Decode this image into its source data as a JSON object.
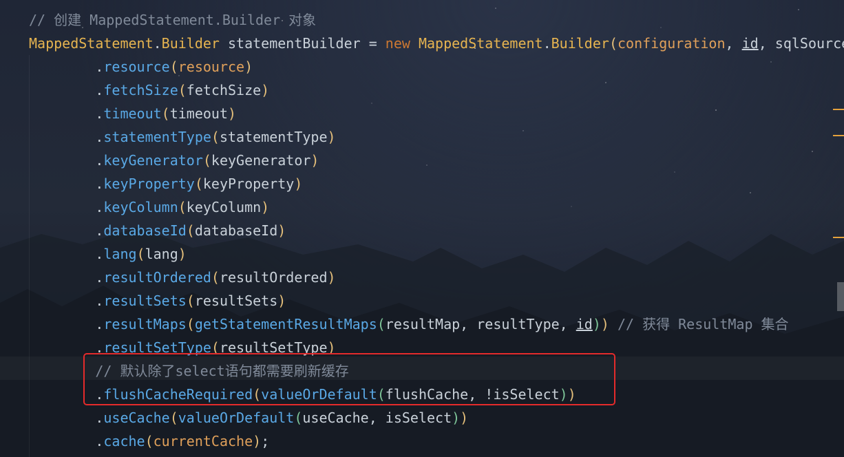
{
  "editor": {
    "lines": [
      [
        {
          "t": "// 创建 MappedStatement.Builder 对象",
          "c": "comment"
        }
      ],
      [
        {
          "t": "MappedStatement",
          "c": "class"
        },
        {
          "t": ".",
          "c": "plain"
        },
        {
          "t": "Builder",
          "c": "class"
        },
        {
          "t": " statementBuilder = ",
          "c": "plain"
        },
        {
          "t": "new",
          "c": "keyword"
        },
        {
          "t": " ",
          "c": "plain"
        },
        {
          "t": "MappedStatement",
          "c": "class"
        },
        {
          "t": ".",
          "c": "plain"
        },
        {
          "t": "Builder",
          "c": "class"
        },
        {
          "t": "(",
          "c": "paren-y"
        },
        {
          "t": "configuration",
          "c": "field"
        },
        {
          "t": ", ",
          "c": "plain"
        },
        {
          "t": "id",
          "c": "param"
        },
        {
          "t": ", sqlSource",
          "c": "plain"
        }
      ],
      [
        {
          "t": "        .",
          "c": "dot"
        },
        {
          "t": "resource",
          "c": "method"
        },
        {
          "t": "(",
          "c": "paren-y"
        },
        {
          "t": "resource",
          "c": "field"
        },
        {
          "t": ")",
          "c": "paren-y"
        }
      ],
      [
        {
          "t": "        .",
          "c": "dot"
        },
        {
          "t": "fetchSize",
          "c": "method"
        },
        {
          "t": "(",
          "c": "paren-y"
        },
        {
          "t": "fetchSize",
          "c": "plain"
        },
        {
          "t": ")",
          "c": "paren-y"
        }
      ],
      [
        {
          "t": "        .",
          "c": "dot"
        },
        {
          "t": "timeout",
          "c": "method"
        },
        {
          "t": "(",
          "c": "paren-y"
        },
        {
          "t": "timeout",
          "c": "plain"
        },
        {
          "t": ")",
          "c": "paren-y"
        }
      ],
      [
        {
          "t": "        .",
          "c": "dot"
        },
        {
          "t": "statementType",
          "c": "method"
        },
        {
          "t": "(",
          "c": "paren-y"
        },
        {
          "t": "statementType",
          "c": "plain"
        },
        {
          "t": ")",
          "c": "paren-y"
        }
      ],
      [
        {
          "t": "        .",
          "c": "dot"
        },
        {
          "t": "keyGenerator",
          "c": "method"
        },
        {
          "t": "(",
          "c": "paren-y"
        },
        {
          "t": "keyGenerator",
          "c": "plain"
        },
        {
          "t": ")",
          "c": "paren-y"
        }
      ],
      [
        {
          "t": "        .",
          "c": "dot"
        },
        {
          "t": "keyProperty",
          "c": "method"
        },
        {
          "t": "(",
          "c": "paren-y"
        },
        {
          "t": "keyProperty",
          "c": "plain"
        },
        {
          "t": ")",
          "c": "paren-y"
        }
      ],
      [
        {
          "t": "        .",
          "c": "dot"
        },
        {
          "t": "keyColumn",
          "c": "method"
        },
        {
          "t": "(",
          "c": "paren-y"
        },
        {
          "t": "keyColumn",
          "c": "plain"
        },
        {
          "t": ")",
          "c": "paren-y"
        }
      ],
      [
        {
          "t": "        .",
          "c": "dot"
        },
        {
          "t": "databaseId",
          "c": "method"
        },
        {
          "t": "(",
          "c": "paren-y"
        },
        {
          "t": "databaseId",
          "c": "plain"
        },
        {
          "t": ")",
          "c": "paren-y"
        }
      ],
      [
        {
          "t": "        .",
          "c": "dot"
        },
        {
          "t": "lang",
          "c": "method"
        },
        {
          "t": "(",
          "c": "paren-y"
        },
        {
          "t": "lang",
          "c": "plain"
        },
        {
          "t": ")",
          "c": "paren-y"
        }
      ],
      [
        {
          "t": "        .",
          "c": "dot"
        },
        {
          "t": "resultOrdered",
          "c": "method"
        },
        {
          "t": "(",
          "c": "paren-y"
        },
        {
          "t": "resultOrdered",
          "c": "plain"
        },
        {
          "t": ")",
          "c": "paren-y"
        }
      ],
      [
        {
          "t": "        .",
          "c": "dot"
        },
        {
          "t": "resultSets",
          "c": "method"
        },
        {
          "t": "(",
          "c": "paren-y"
        },
        {
          "t": "resultSets",
          "c": "plain"
        },
        {
          "t": ")",
          "c": "paren-y"
        }
      ],
      [
        {
          "t": "        .",
          "c": "dot"
        },
        {
          "t": "resultMaps",
          "c": "method"
        },
        {
          "t": "(",
          "c": "paren-y"
        },
        {
          "t": "getStatementResultMaps",
          "c": "method"
        },
        {
          "t": "(",
          "c": "paren-g"
        },
        {
          "t": "resultMap, resultType, ",
          "c": "plain"
        },
        {
          "t": "id",
          "c": "param"
        },
        {
          "t": ")",
          "c": "paren-g"
        },
        {
          "t": ")",
          "c": "paren-y"
        },
        {
          "t": " // 获得 ResultMap 集合",
          "c": "comment"
        }
      ],
      [
        {
          "t": "        .",
          "c": "dot"
        },
        {
          "t": "resultSetType",
          "c": "method"
        },
        {
          "t": "(",
          "c": "paren-y"
        },
        {
          "t": "resultSetType",
          "c": "plain"
        },
        {
          "t": ")",
          "c": "paren-y"
        }
      ],
      [
        {
          "t": "        // 默认除了select语句都需要刷新缓存",
          "c": "comment"
        }
      ],
      [
        {
          "t": "        .",
          "c": "dot"
        },
        {
          "t": "flushCacheRequired",
          "c": "method"
        },
        {
          "t": "(",
          "c": "paren-y"
        },
        {
          "t": "valueOrDefault",
          "c": "method"
        },
        {
          "t": "(",
          "c": "paren-g"
        },
        {
          "t": "flushCache, !isSelect",
          "c": "plain"
        },
        {
          "t": ")",
          "c": "paren-g"
        },
        {
          "t": ")",
          "c": "paren-y"
        }
      ],
      [
        {
          "t": "        .",
          "c": "dot"
        },
        {
          "t": "useCache",
          "c": "method"
        },
        {
          "t": "(",
          "c": "paren-y"
        },
        {
          "t": "valueOrDefault",
          "c": "method"
        },
        {
          "t": "(",
          "c": "paren-g"
        },
        {
          "t": "useCache, isSelect",
          "c": "plain"
        },
        {
          "t": ")",
          "c": "paren-g"
        },
        {
          "t": ")",
          "c": "paren-y"
        }
      ],
      [
        {
          "t": "        .",
          "c": "dot"
        },
        {
          "t": "cache",
          "c": "method"
        },
        {
          "t": "(",
          "c": "paren-y"
        },
        {
          "t": "currentCache",
          "c": "field"
        },
        {
          "t": ")",
          "c": "paren-y"
        },
        {
          "t": ";",
          "c": "plain"
        }
      ]
    ]
  }
}
